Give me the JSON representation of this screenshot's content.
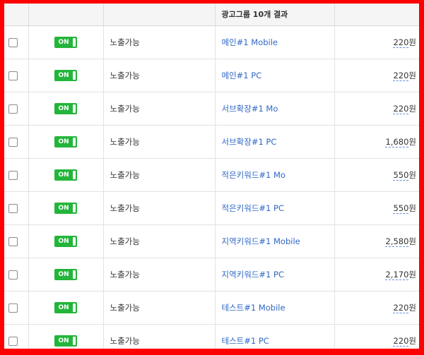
{
  "header": {
    "col_checkbox": "",
    "col_toggle": "",
    "col_status": "",
    "col_name": "광고그룹 10개 결과",
    "col_bid": ""
  },
  "rows": [
    {
      "toggle": "ON",
      "status": "노출가능",
      "name": "메인#1 Mobile",
      "bid": "220",
      "unit": "원"
    },
    {
      "toggle": "ON",
      "status": "노출가능",
      "name": "메인#1 PC",
      "bid": "220",
      "unit": "원"
    },
    {
      "toggle": "ON",
      "status": "노출가능",
      "name": "서브확장#1 Mo",
      "bid": "220",
      "unit": "원"
    },
    {
      "toggle": "ON",
      "status": "노출가능",
      "name": "서브확장#1 PC",
      "bid": "1,680",
      "unit": "원"
    },
    {
      "toggle": "ON",
      "status": "노출가능",
      "name": "적은키워드#1 Mo",
      "bid": "550",
      "unit": "원"
    },
    {
      "toggle": "ON",
      "status": "노출가능",
      "name": "적은키워드#1 PC",
      "bid": "550",
      "unit": "원"
    },
    {
      "toggle": "ON",
      "status": "노출가능",
      "name": "지역키워드#1 Mobile",
      "bid": "2,580",
      "unit": "원"
    },
    {
      "toggle": "ON",
      "status": "노출가능",
      "name": "지역키워드#1 PC",
      "bid": "2,170",
      "unit": "원"
    },
    {
      "toggle": "ON",
      "status": "노출가능",
      "name": "테스트#1 Mobile",
      "bid": "220",
      "unit": "원"
    },
    {
      "toggle": "ON",
      "status": "노출가능",
      "name": "테스트#1 PC",
      "bid": "220",
      "unit": "원"
    }
  ],
  "colors": {
    "frame": "#ff0000",
    "toggle_on": "#23b53a",
    "link": "#2f67c6",
    "header_bg": "#f5f5f5"
  }
}
